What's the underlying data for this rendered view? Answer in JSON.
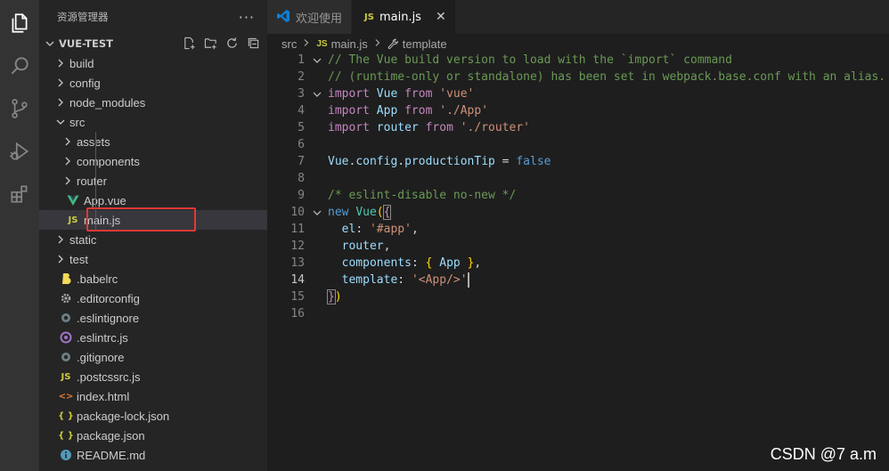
{
  "sidebar": {
    "title": "资源管理器",
    "more": "···",
    "project": "VUE-TEST",
    "items": [
      {
        "label": "build",
        "type": "folder",
        "depth": 0
      },
      {
        "label": "config",
        "type": "folder",
        "depth": 0
      },
      {
        "label": "node_modules",
        "type": "folder",
        "depth": 0
      },
      {
        "label": "src",
        "type": "folder-open",
        "depth": 0
      },
      {
        "label": "assets",
        "type": "folder",
        "depth": 1
      },
      {
        "label": "components",
        "type": "folder",
        "depth": 1
      },
      {
        "label": "router",
        "type": "folder",
        "depth": 1
      },
      {
        "label": "App.vue",
        "type": "vue",
        "depth": 1
      },
      {
        "label": "main.js",
        "type": "js",
        "depth": 1,
        "selected": true
      },
      {
        "label": "static",
        "type": "folder",
        "depth": 0
      },
      {
        "label": "test",
        "type": "folder",
        "depth": 0
      },
      {
        "label": ".babelrc",
        "type": "babel",
        "depth": 0
      },
      {
        "label": ".editorconfig",
        "type": "gear",
        "depth": 0
      },
      {
        "label": ".eslintignore",
        "type": "dot",
        "depth": 0
      },
      {
        "label": ".eslintrc.js",
        "type": "eslint",
        "depth": 0
      },
      {
        "label": ".gitignore",
        "type": "dot",
        "depth": 0
      },
      {
        "label": ".postcssrc.js",
        "type": "js",
        "depth": 0
      },
      {
        "label": "index.html",
        "type": "html",
        "depth": 0
      },
      {
        "label": "package-lock.json",
        "type": "json",
        "depth": 0
      },
      {
        "label": "package.json",
        "type": "json",
        "depth": 0
      },
      {
        "label": "README.md",
        "type": "info",
        "depth": 0
      }
    ]
  },
  "tabs": [
    {
      "label": "欢迎使用",
      "icon": "vscode-icon",
      "active": false
    },
    {
      "label": "main.js",
      "icon": "JS",
      "active": true,
      "close": "✕"
    }
  ],
  "breadcrumb": {
    "folder": "src",
    "file_badge": "JS",
    "file": "main.js",
    "symbol": "template"
  },
  "icons": {
    "js": "JS",
    "json": "{ }",
    "html": "<>"
  },
  "code": {
    "current_line": 14,
    "lines": [
      {
        "n": "1",
        "fold": true
      },
      {
        "n": "2",
        "fold": false
      },
      {
        "n": "3",
        "fold": true
      },
      {
        "n": "4",
        "fold": false
      },
      {
        "n": "5",
        "fold": false
      },
      {
        "n": "6",
        "fold": false
      },
      {
        "n": "7",
        "fold": false
      },
      {
        "n": "8",
        "fold": false
      },
      {
        "n": "9",
        "fold": false
      },
      {
        "n": "10",
        "fold": true
      },
      {
        "n": "11",
        "fold": false
      },
      {
        "n": "12",
        "fold": false
      },
      {
        "n": "13",
        "fold": false
      },
      {
        "n": "14",
        "fold": false
      },
      {
        "n": "15",
        "fold": false
      },
      {
        "n": "16",
        "fold": false
      }
    ],
    "tokens": {
      "l1": "// The Vue build version to load with the `import` command",
      "l2": "// (runtime-only or standalone) has been set in webpack.base.conf with an alias.",
      "import": "import",
      "from": "from",
      "vue_id": "Vue",
      "vue_str": "'vue'",
      "app_id": "App",
      "app_str": "'./App'",
      "router_id": "router",
      "router_str": "'./router'",
      "l7_vue": "Vue",
      "l7_config": "config",
      "l7_prop": "productionTip",
      "l7_eq": " = ",
      "l7_false": "false",
      "dot": ".",
      "l9": "/* eslint-disable no-new */",
      "new": "new",
      "l10_vue": "Vue",
      "paren_open": "(",
      "brace_open": "{",
      "el": "el",
      "colon": ": ",
      "el_val": "'#app'",
      "comma": ",",
      "router": "router",
      "components": "components",
      "components_val_open": "{ ",
      "components_app": "App",
      "components_val_close": " }",
      "template": "template",
      "template_val": "'<App/>'",
      "brace_close": "}",
      "paren_close": ")"
    }
  },
  "watermark": "CSDN @7 a.m"
}
